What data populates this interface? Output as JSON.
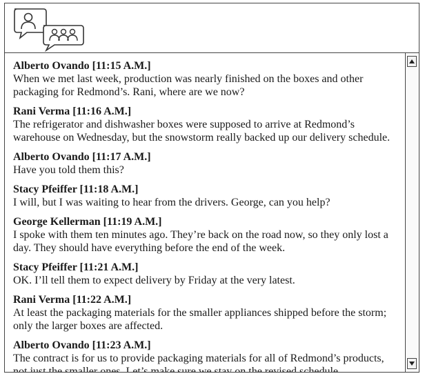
{
  "window": {
    "logo_icon": "chat-bubbles-people-icon"
  },
  "messages": [
    {
      "sender": "Alberto Ovando",
      "time": "[11:15 A.M.]",
      "text": "When we met last week, production was nearly finished on the boxes and other packaging for Redmond’s. Rani, where are we now?"
    },
    {
      "sender": "Rani Verma",
      "time": "[11:16 A.M.]",
      "text": "The refrigerator and dishwasher boxes were supposed to arrive at Redmond’s warehouse on Wednesday, but the snowstorm really backed up our delivery schedule."
    },
    {
      "sender": "Alberto Ovando",
      "time": "[11:17 A.M.]",
      "text": "Have you told them this?"
    },
    {
      "sender": "Stacy Pfeiffer",
      "time": "[11:18 A.M.]",
      "text": "I will, but I was waiting to hear from the drivers. George, can you help?"
    },
    {
      "sender": "George Kellerman",
      "time": "[11:19 A.M.]",
      "text": "I spoke with them ten minutes ago. They’re back on the road now, so they only lost a day. They should have everything before the end of the week."
    },
    {
      "sender": "Stacy Pfeiffer",
      "time": "[11:21 A.M.]",
      "text": "OK. I’ll tell them to expect delivery by Friday at the very latest."
    },
    {
      "sender": "Rani Verma",
      "time": "[11:22 A.M.]",
      "text": "At least the packaging materials for the smaller appliances shipped before the storm; only the larger boxes are affected."
    },
    {
      "sender": "Alberto Ovando",
      "time": "[11:23 A.M.]",
      "text": "The contract is for us to provide packaging materials for all of Redmond’s products, not just the smaller ones. Let’s make sure we stay on the revised schedule."
    }
  ],
  "scrollbar": {
    "up_icon": "arrow-up-icon",
    "down_icon": "arrow-down-icon"
  }
}
